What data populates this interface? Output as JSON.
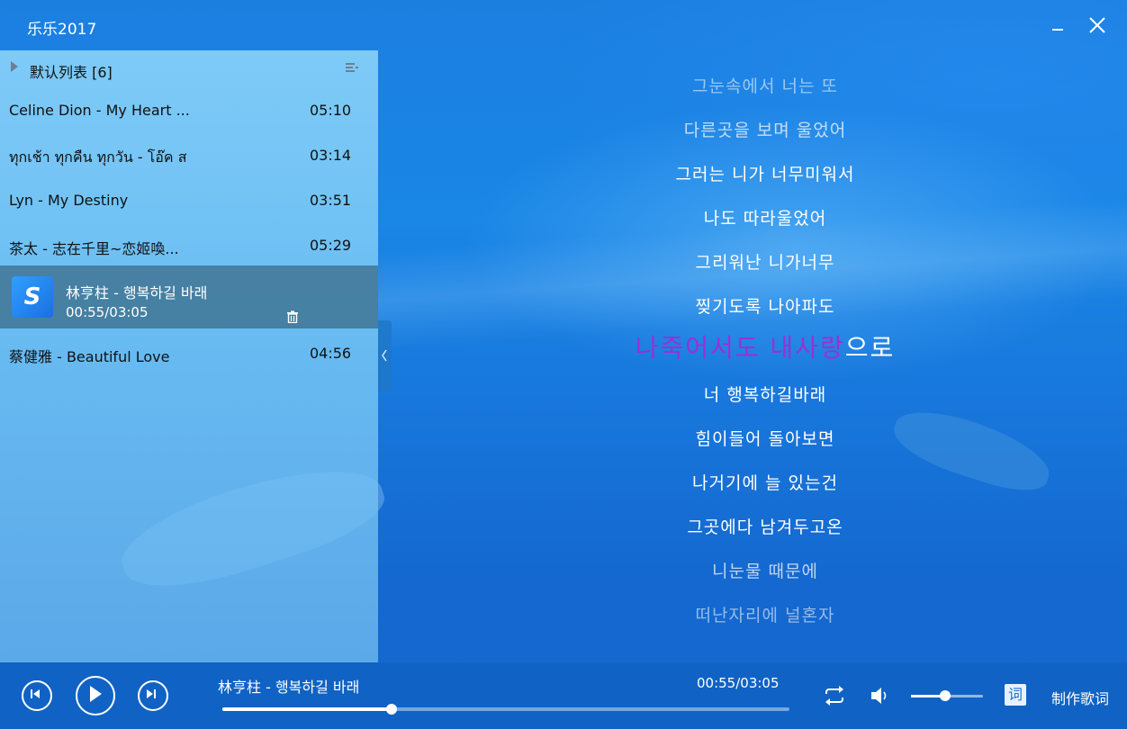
{
  "app": {
    "title": "乐乐2017"
  },
  "playlist": {
    "title": "默认列表 [6]",
    "tracks": [
      {
        "name": "Celine Dion - My Heart ...",
        "duration": "05:10"
      },
      {
        "name": "ทุกเช้า ทุกคืน ทุกวัน - โอ๊ค ส",
        "duration": "03:14"
      },
      {
        "name": "Lyn - My Destiny",
        "duration": "03:51"
      },
      {
        "name": "茶太 - 志在千里~恋姬喚...",
        "duration": "05:29"
      },
      {
        "name": "林亨柱 - 행복하길 바래",
        "time": "00:55/03:05"
      },
      {
        "name": "蔡健雅 - Beautiful Love",
        "duration": "04:56"
      }
    ]
  },
  "lyrics": {
    "before": [
      "그눈속에서 너는 또",
      "다른곳을 보며 울었어",
      "그러는 니가 너무미워서",
      "나도 따라울었어",
      "그리워난 니가너무",
      "찢기도록 나아파도"
    ],
    "current_sung": "나죽어서도 내사랑",
    "current_unsung": "으로",
    "after": [
      "너 행복하길바래",
      "힘이들어 돌아보면",
      "나거기에 늘 있는건",
      "그곳에다 남겨두고온",
      "니눈물 때문에",
      "떠난자리에 널혼자"
    ]
  },
  "player": {
    "now_playing": "林亨柱 - 행복하길 바래",
    "time": "00:55/03:05",
    "progress": 0.299,
    "volume": 0.48,
    "lyric_toggle_label": "词",
    "make_lyrics_label": "制作歌词"
  },
  "colors": {
    "accent": "#1b7fe0",
    "sung_lyric": "#9a2fd8",
    "active_row": "#3c6e8c"
  }
}
